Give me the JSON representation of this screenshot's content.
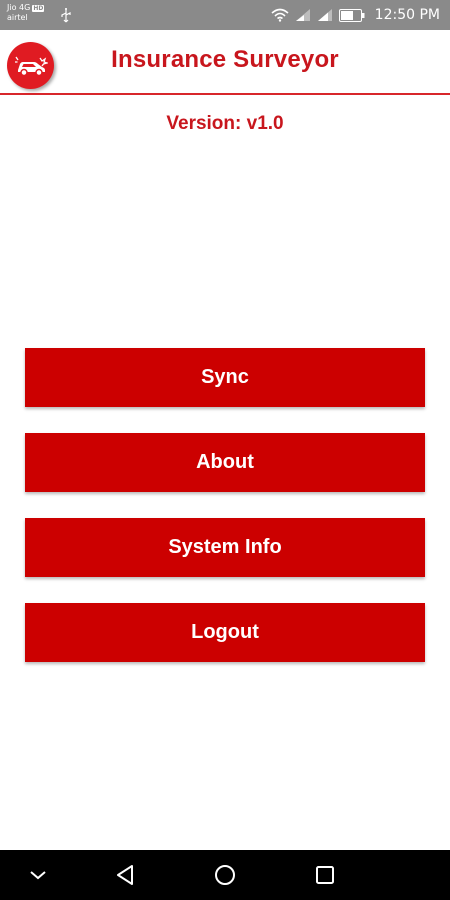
{
  "status_bar": {
    "carrier_1": "Jio 4G",
    "network_badge": "HD",
    "carrier_2": "airtel",
    "time": "12:50 PM"
  },
  "app_bar": {
    "title": "Insurance Surveyor",
    "logo_icon": "car-crash-icon",
    "accent_color": "#c8161d"
  },
  "version_text": "Version: v1.0",
  "menu": {
    "button_color": "#cc0000",
    "buttons": [
      {
        "label": "Sync"
      },
      {
        "label": "About"
      },
      {
        "label": "System Info"
      },
      {
        "label": "Logout"
      }
    ]
  },
  "nav_bar": {
    "icons": [
      "chevron-down-icon",
      "back-triangle-icon",
      "home-circle-icon",
      "recent-apps-square-icon"
    ]
  }
}
